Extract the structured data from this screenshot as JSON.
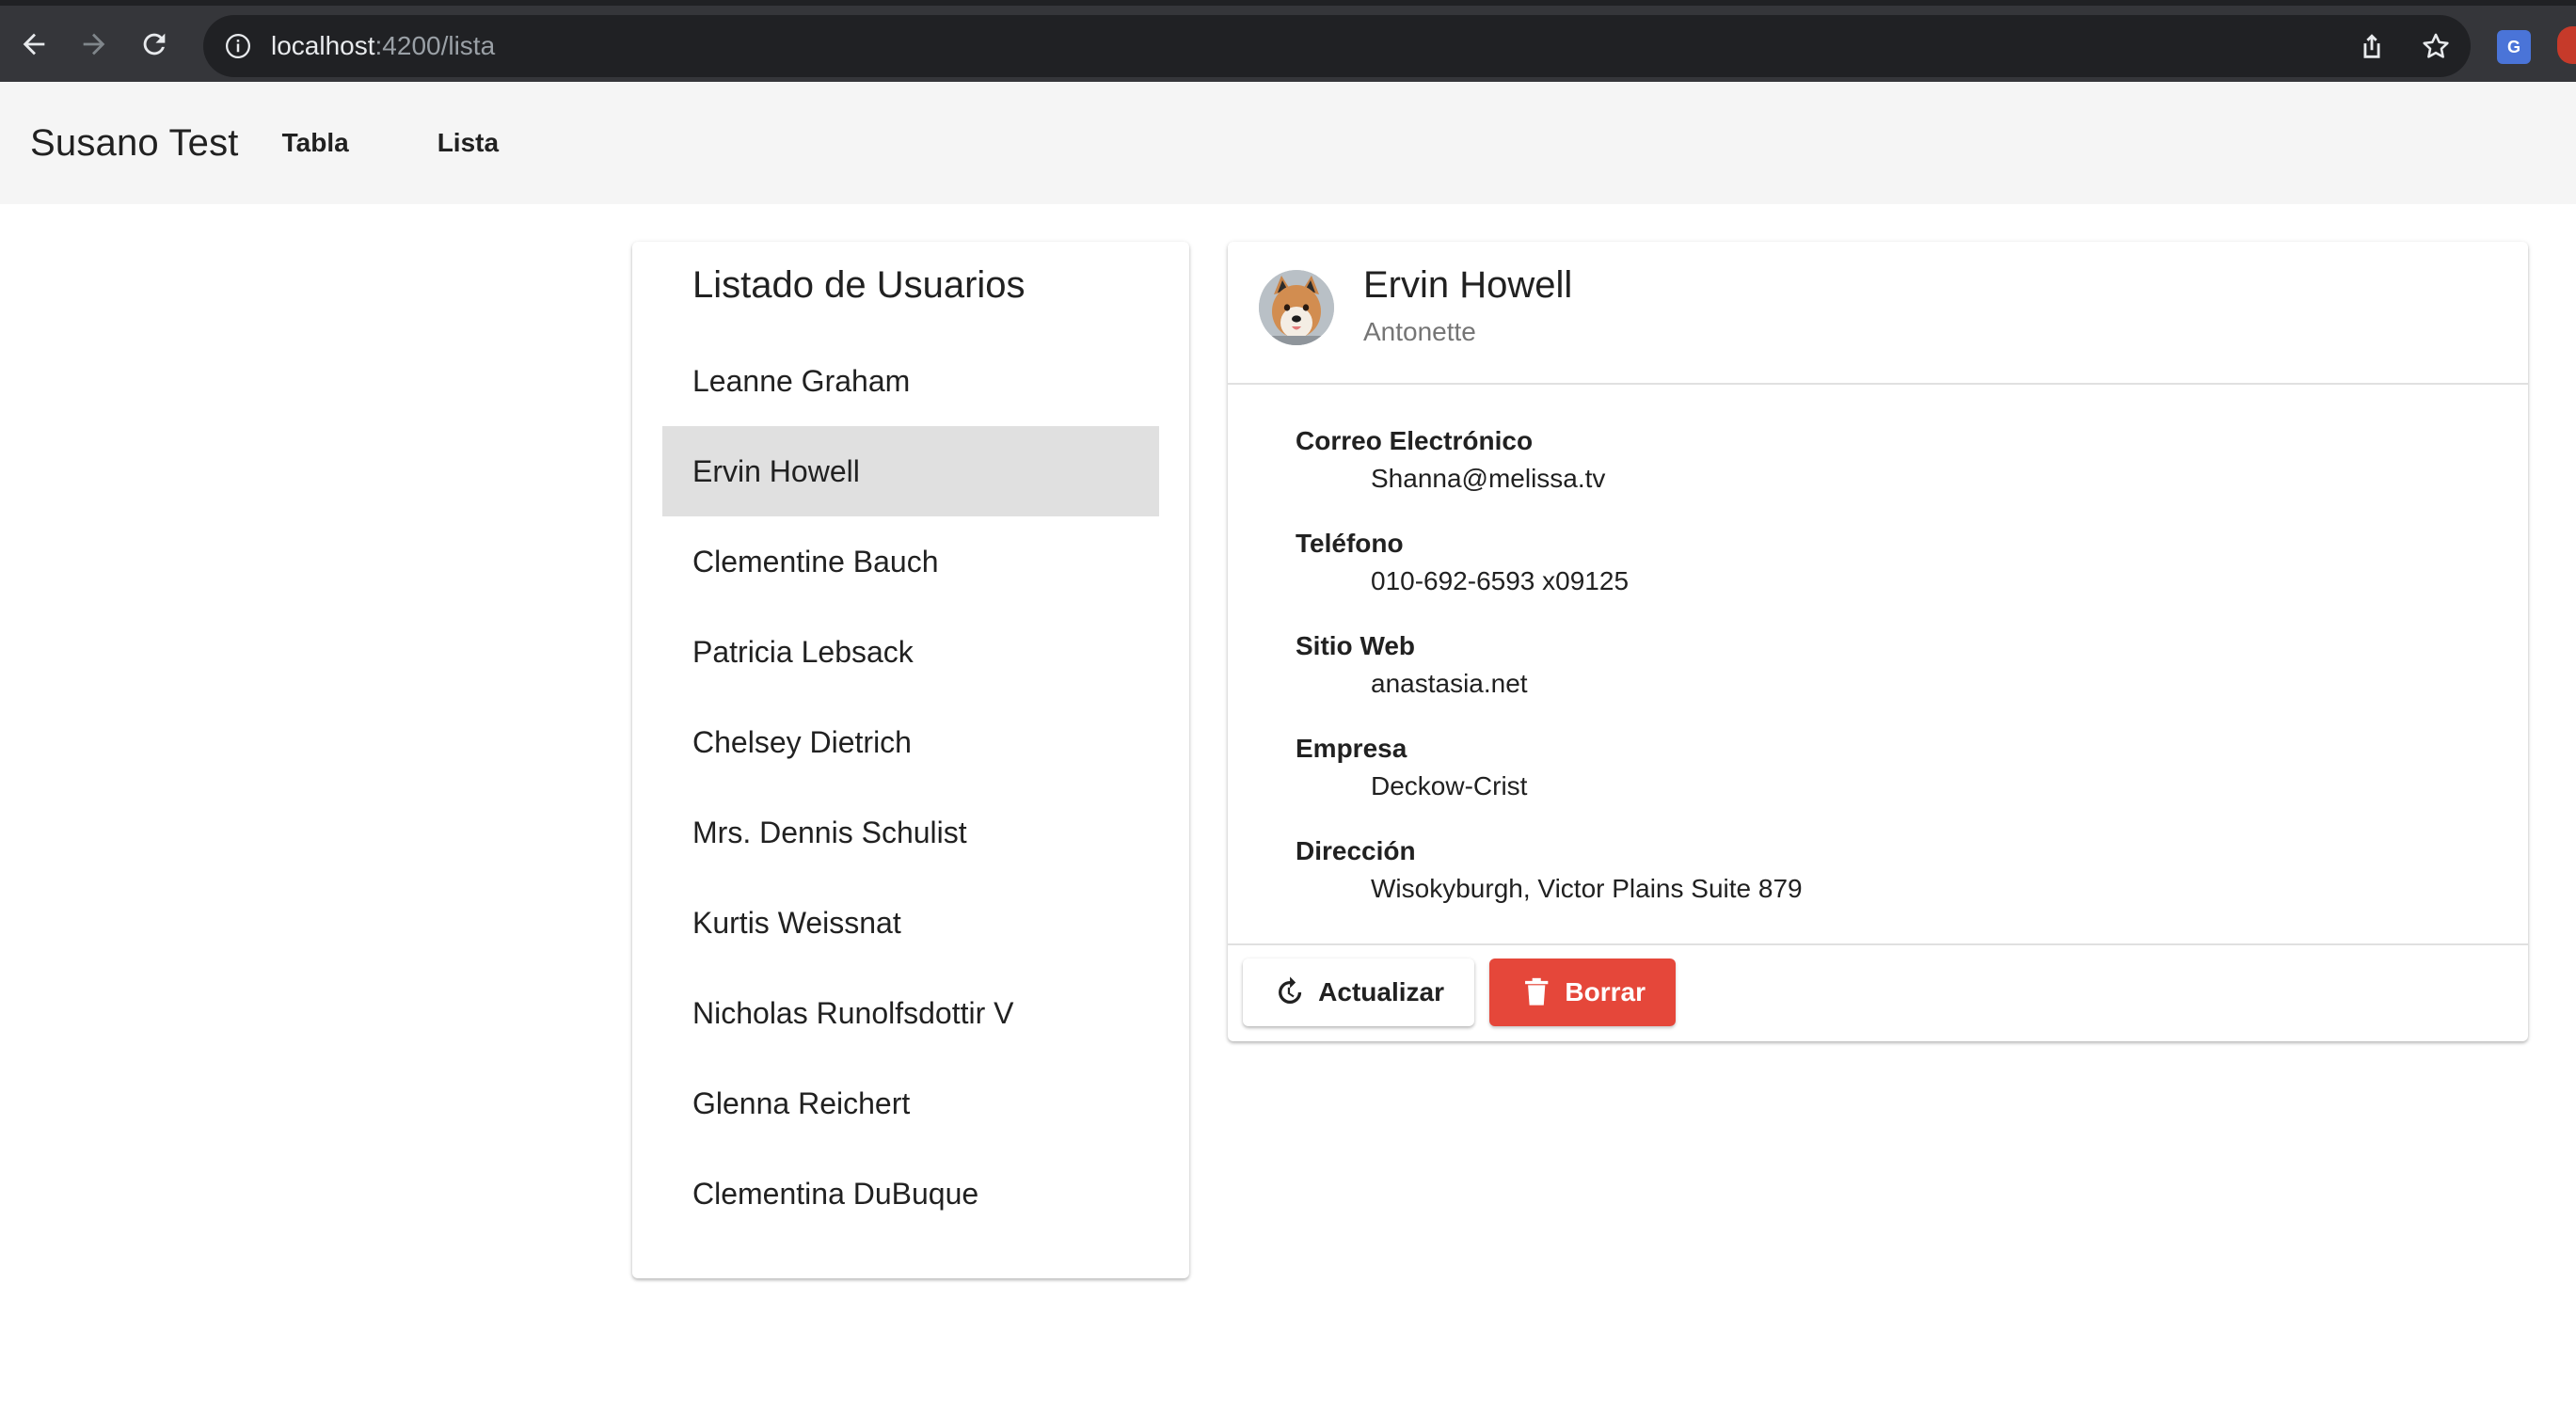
{
  "browser": {
    "url_host": "localhost",
    "url_path": ":4200/lista"
  },
  "toolbar": {
    "brand": "Susano Test",
    "links": [
      "Tabla",
      "Lista"
    ]
  },
  "list": {
    "title": "Listado de Usuarios",
    "selected_index": 1,
    "users": [
      "Leanne Graham",
      "Ervin Howell",
      "Clementine Bauch",
      "Patricia Lebsack",
      "Chelsey Dietrich",
      "Mrs. Dennis Schulist",
      "Kurtis Weissnat",
      "Nicholas Runolfsdottir V",
      "Glenna Reichert",
      "Clementina DuBuque"
    ]
  },
  "detail": {
    "name": "Ervin Howell",
    "username": "Antonette",
    "fields": [
      {
        "label": "Correo Electrónico",
        "value": "Shanna@melissa.tv"
      },
      {
        "label": "Teléfono",
        "value": "010-692-6593 x09125"
      },
      {
        "label": "Sitio Web",
        "value": "anastasia.net"
      },
      {
        "label": "Empresa",
        "value": "Deckow-Crist"
      },
      {
        "label": "Dirección",
        "value": "Wisokyburgh, Victor Plains Suite 879"
      }
    ],
    "update_label": "Actualizar",
    "delete_label": "Borrar"
  },
  "colors": {
    "delete_accent": "#e5473a",
    "selected_row": "#e0e0e0",
    "toolbar_bg": "#f5f5f5"
  }
}
